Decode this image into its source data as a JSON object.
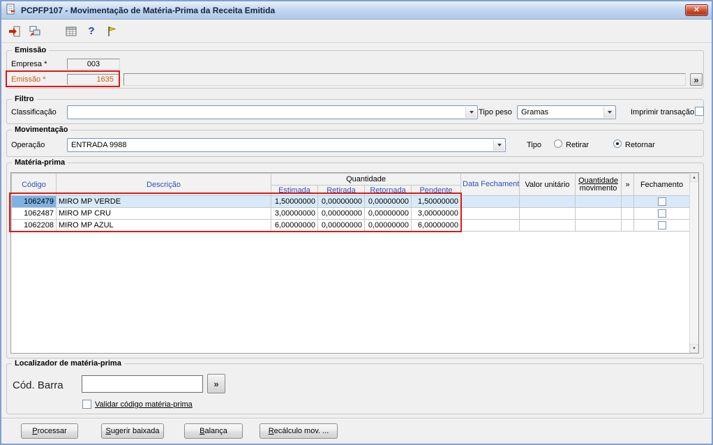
{
  "window": {
    "title": "PCPFP107 - Movimentação de Matéria-Prima da Receita Emitida",
    "close_glyph": "✕"
  },
  "toolbar": {
    "icons": [
      "exit-icon",
      "switch-form-icon",
      "spreadsheet-icon",
      "help-icon",
      "notes-icon"
    ]
  },
  "emissao": {
    "legend": "Emissão",
    "empresa_label": "Empresa *",
    "empresa_value": "003",
    "emissao_label": "Emissão *",
    "emissao_value": "1635",
    "descricao_value": "",
    "lookup_button": "»"
  },
  "filtro": {
    "legend": "Filtro",
    "classificacao_label": "Classificação",
    "classificacao_value": "",
    "tipo_peso_label": "Tipo peso",
    "tipo_peso_value": "Gramas",
    "imprimir_transacao_label": "Imprimir transação",
    "imprimir_transacao_checked": false
  },
  "movimentacao": {
    "legend": "Movimentação",
    "operacao_label": "Operação",
    "operacao_value": "ENTRADA 9988",
    "tipo_label": "Tipo",
    "retirar_label": "Retirar",
    "retornar_label": "Retornar",
    "tipo_selected": "Retornar"
  },
  "materia_prima": {
    "legend": "Matéria-prima",
    "headers": {
      "codigo": "Código",
      "descricao": "Descrição",
      "quantidade": "Quantidade",
      "estimada": "Estimada",
      "retirada": "Retirada",
      "retornada": "Retornada",
      "pendente": "Pendente",
      "data_fechamento": "Data Fechamento",
      "valor_unitario": "Valor unitário",
      "quantidade_movimento_l1": "Quantidade",
      "quantidade_movimento_l2": "movimento",
      "chevron": "»",
      "fechamento": "Fechamento"
    },
    "rows": [
      {
        "codigo": "1062479",
        "descricao": "MIRO MP VERDE",
        "estimada": "1,50000000",
        "retirada": "0,00000000",
        "retornada": "0,00000000",
        "pendente": "1,50000000",
        "data_fechamento": "",
        "valor_unitario": "",
        "quantidade_movimento": "",
        "fechamento_checked": false,
        "selected": true
      },
      {
        "codigo": "1062487",
        "descricao": "MIRO MP CRU",
        "estimada": "3,00000000",
        "retirada": "0,00000000",
        "retornada": "0,00000000",
        "pendente": "3,00000000",
        "data_fechamento": "",
        "valor_unitario": "",
        "quantidade_movimento": "",
        "fechamento_checked": false,
        "selected": false
      },
      {
        "codigo": "1062208",
        "descricao": "MIRO MP AZUL",
        "estimada": "6,00000000",
        "retirada": "0,00000000",
        "retornada": "0,00000000",
        "pendente": "6,00000000",
        "data_fechamento": "",
        "valor_unitario": "",
        "quantidade_movimento": "",
        "fechamento_checked": false,
        "selected": false
      }
    ]
  },
  "localizador": {
    "legend": "Localizador de matéria-prima",
    "cod_barra_label": "Cód. Barra",
    "cod_barra_value": "",
    "lookup_button": "»",
    "validar_label": "Validar código matéria-prima",
    "validar_checked": false
  },
  "actions": {
    "processar": "Processar",
    "sugerir_baixada": "Sugerir baixada",
    "balanca": "Balança",
    "recalculo": "Recálculo mov. ..."
  },
  "scrollbar": {
    "up": "▲",
    "down": "▼"
  },
  "colors": {
    "annotation": "#E01616",
    "highlight_text": "#C85E10",
    "header_link": "#2B50BE",
    "selected_row_bg": "#D8EAF9",
    "selected_cell_bg": "#7EB2E4"
  }
}
